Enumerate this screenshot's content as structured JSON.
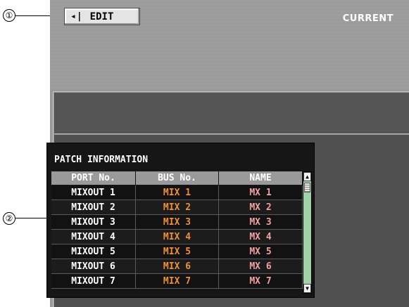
{
  "callouts": [
    "①",
    "②"
  ],
  "toolbar": {
    "edit_icon": "◂|",
    "edit_label": "EDIT",
    "current_label": "CURRENT"
  },
  "patch_info": {
    "title": "PATCH INFORMATION",
    "columns": [
      "PORT No.",
      "BUS No.",
      "NAME"
    ],
    "rows": [
      {
        "port": "MIXOUT 1",
        "bus": "MIX 1",
        "name": "MX 1"
      },
      {
        "port": "MIXOUT 2",
        "bus": "MIX 2",
        "name": "MX 2"
      },
      {
        "port": "MIXOUT 3",
        "bus": "MIX 3",
        "name": "MX 3"
      },
      {
        "port": "MIXOUT 4",
        "bus": "MIX 4",
        "name": "MX 4"
      },
      {
        "port": "MIXOUT 5",
        "bus": "MIX 5",
        "name": "MX 5"
      },
      {
        "port": "MIXOUT 6",
        "bus": "MIX 6",
        "name": "MX 6"
      },
      {
        "port": "MIXOUT 7",
        "bus": "MIX 7",
        "name": "MX 7"
      }
    ],
    "scroll_up_icon": "▲",
    "scroll_down_icon": "▼"
  },
  "colors": {
    "bus_text": "#f09030",
    "name_text": "#f2a0a0",
    "scroll_track": "#9fd2a7"
  }
}
